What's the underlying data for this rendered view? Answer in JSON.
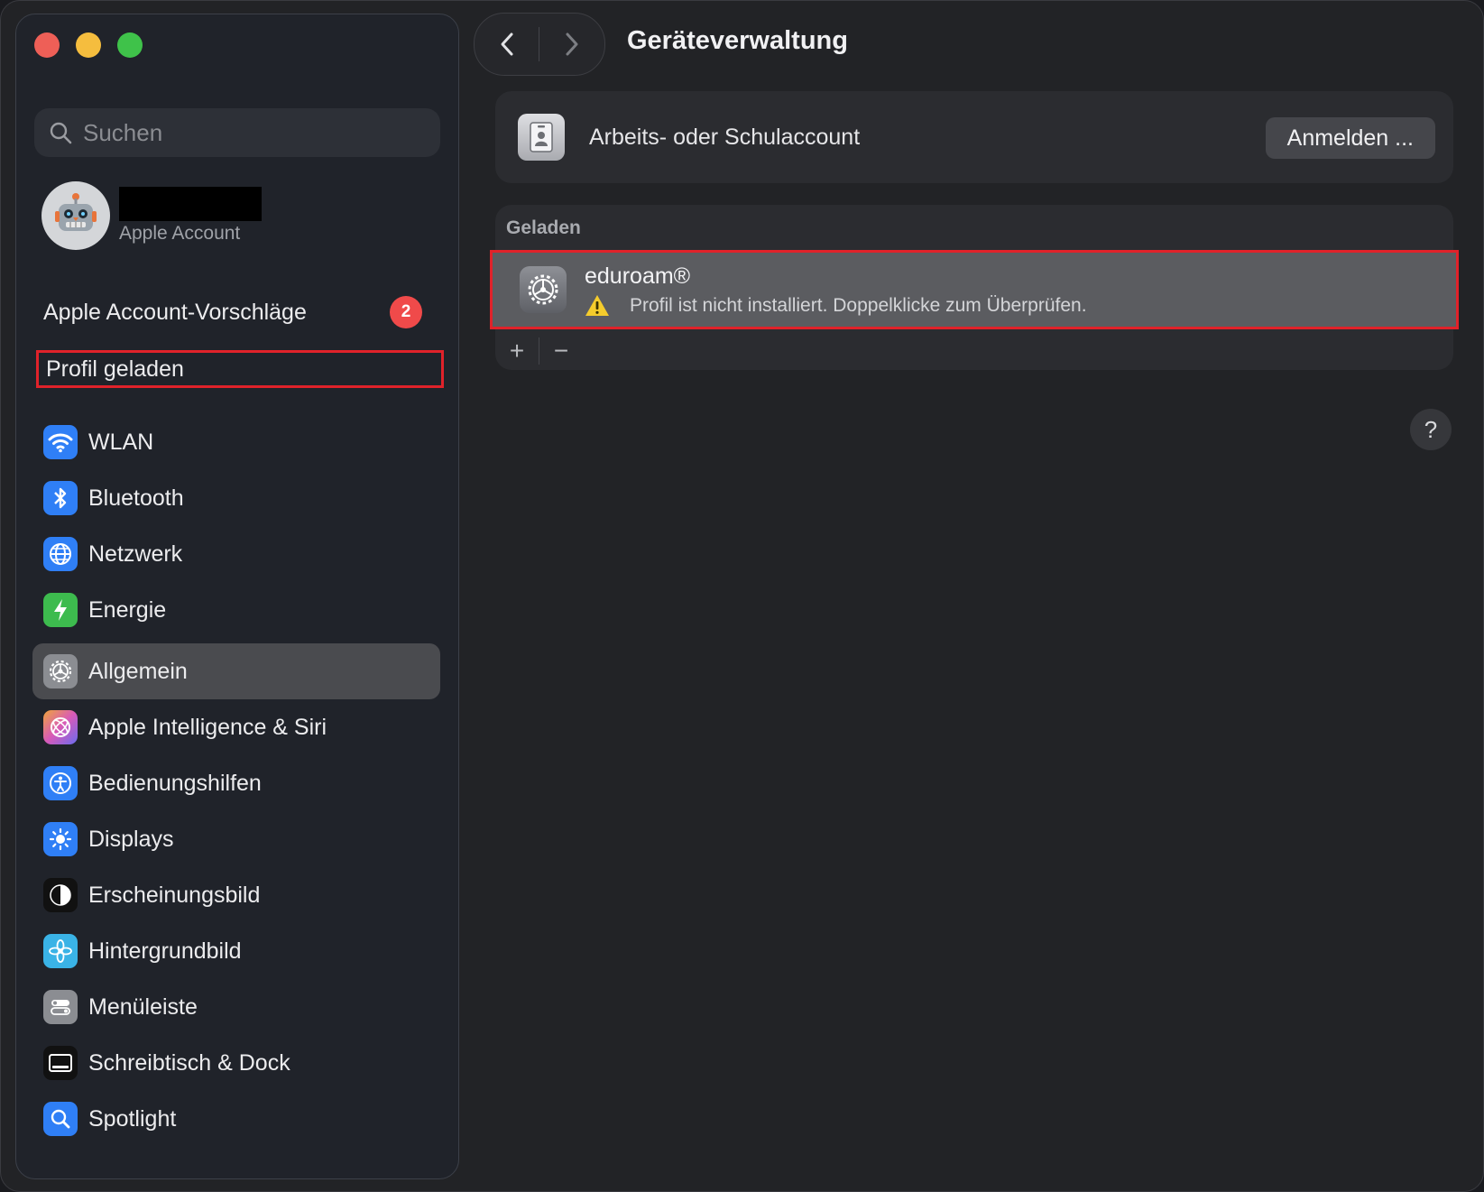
{
  "window": {
    "title": "Geräteverwaltung"
  },
  "search": {
    "placeholder": "Suchen"
  },
  "account": {
    "subtitle": "Apple Account"
  },
  "suggestions": {
    "label": "Apple Account-Vorschläge",
    "badge": "2"
  },
  "loaded_profile": {
    "label": "Profil geladen"
  },
  "sidebar": {
    "group1": [
      {
        "label": "WLAN",
        "icon": "wifi-icon",
        "color": "#2f7ff6"
      },
      {
        "label": "Bluetooth",
        "icon": "bluetooth-icon",
        "color": "#2f7ff6"
      },
      {
        "label": "Netzwerk",
        "icon": "globe-icon",
        "color": "#2f7ff6"
      },
      {
        "label": "Energie",
        "icon": "bolt-icon",
        "color": "#3dbb4e"
      }
    ],
    "group2": [
      {
        "label": "Allgemein",
        "icon": "gear-icon",
        "color": "#8b8d92",
        "active": true
      },
      {
        "label": "Apple Intelligence & Siri",
        "icon": "siri-icon",
        "color": "#d86cb4"
      },
      {
        "label": "Bedienungshilfen",
        "icon": "accessibility-icon",
        "color": "#2f7ff6"
      },
      {
        "label": "Displays",
        "icon": "sun-icon",
        "color": "#2f7ff6"
      },
      {
        "label": "Erscheinungsbild",
        "icon": "appearance-icon",
        "color": "#111111"
      },
      {
        "label": "Hintergrundbild",
        "icon": "flower-icon",
        "color": "#3ab3e6"
      },
      {
        "label": "Menüleiste",
        "icon": "menubar-icon",
        "color": "#8b8d92"
      },
      {
        "label": "Schreibtisch & Dock",
        "icon": "dock-icon",
        "color": "#111111"
      },
      {
        "label": "Spotlight",
        "icon": "spotlight-icon",
        "color": "#2f7ff6"
      }
    ]
  },
  "main": {
    "work_account": {
      "label": "Arbeits- oder Schulaccount",
      "button": "Anmelden ..."
    },
    "section_label": "Geladen",
    "profile": {
      "name": "eduroam®",
      "status": "Profil ist nicht installiert. Doppelklicke zum Überprüfen."
    },
    "add_label": "+",
    "remove_label": "−",
    "help_label": "?"
  }
}
